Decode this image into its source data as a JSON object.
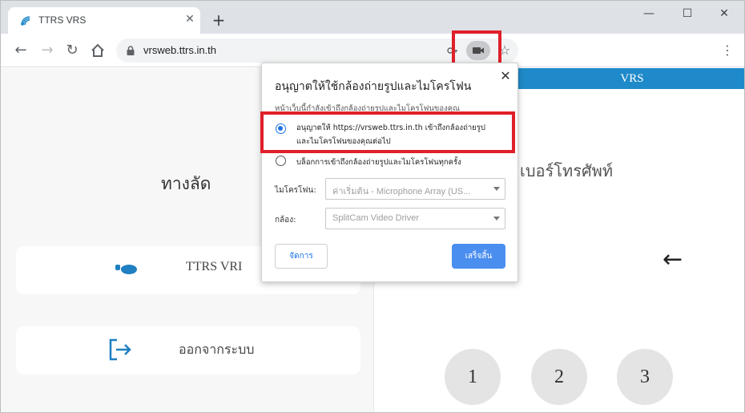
{
  "browser": {
    "tab_title": "TTRS VRS",
    "new_tab": "+",
    "url": "vrsweb.ttrs.in.th"
  },
  "page": {
    "vrs_header": "VRS",
    "shortcut_title": "ทางลัด",
    "vri_label": "TTRS VRI",
    "logout_label": "ออกจากระบบ",
    "phone_label": "เบอร์โทรศัพท์",
    "back_arrow": "←",
    "keypad": [
      "1",
      "2",
      "3"
    ]
  },
  "popup": {
    "title": "อนุญาตให้ใช้กล้องถ่ายรูปและไมโครโฟน",
    "subtitle": "หน้าเว็บนี้กำลังเข้าถึงกล้องถ่ายรูปและไมโครโฟนของคุณ",
    "option_allow_line1": "อนุญาตให้ https://vrsweb.ttrs.in.th เข้าถึงกล้องถ่ายรูป",
    "option_allow_line2": "และไมโครโฟนของคุณต่อไป",
    "option_block": "บล็อกการเข้าถึงกล้องถ่ายรูปและไมโครโฟนทุกครั้ง",
    "mic_label": "ไมโครโฟน:",
    "mic_value": "ค่าเริ่มต้น - Microphone Array (US...",
    "camera_label": "กล้อง:",
    "camera_value": "SplitCam Video Driver",
    "manage_label": "จัดการ",
    "done_label": "เสร็จสิ้น",
    "selected_option": "allow"
  },
  "colors": {
    "highlight": "#e0202a",
    "accent": "#1a73e8",
    "vrs_bar": "#1f8ac9",
    "done_button": "#4a8ef0"
  },
  "icons": [
    "ttrs-favicon",
    "close-icon",
    "back-icon",
    "forward-icon",
    "reload-icon",
    "home-icon",
    "lock-icon",
    "key-icon",
    "camera-icon",
    "star-icon",
    "menu-icon",
    "hand-icon",
    "logout-icon"
  ]
}
